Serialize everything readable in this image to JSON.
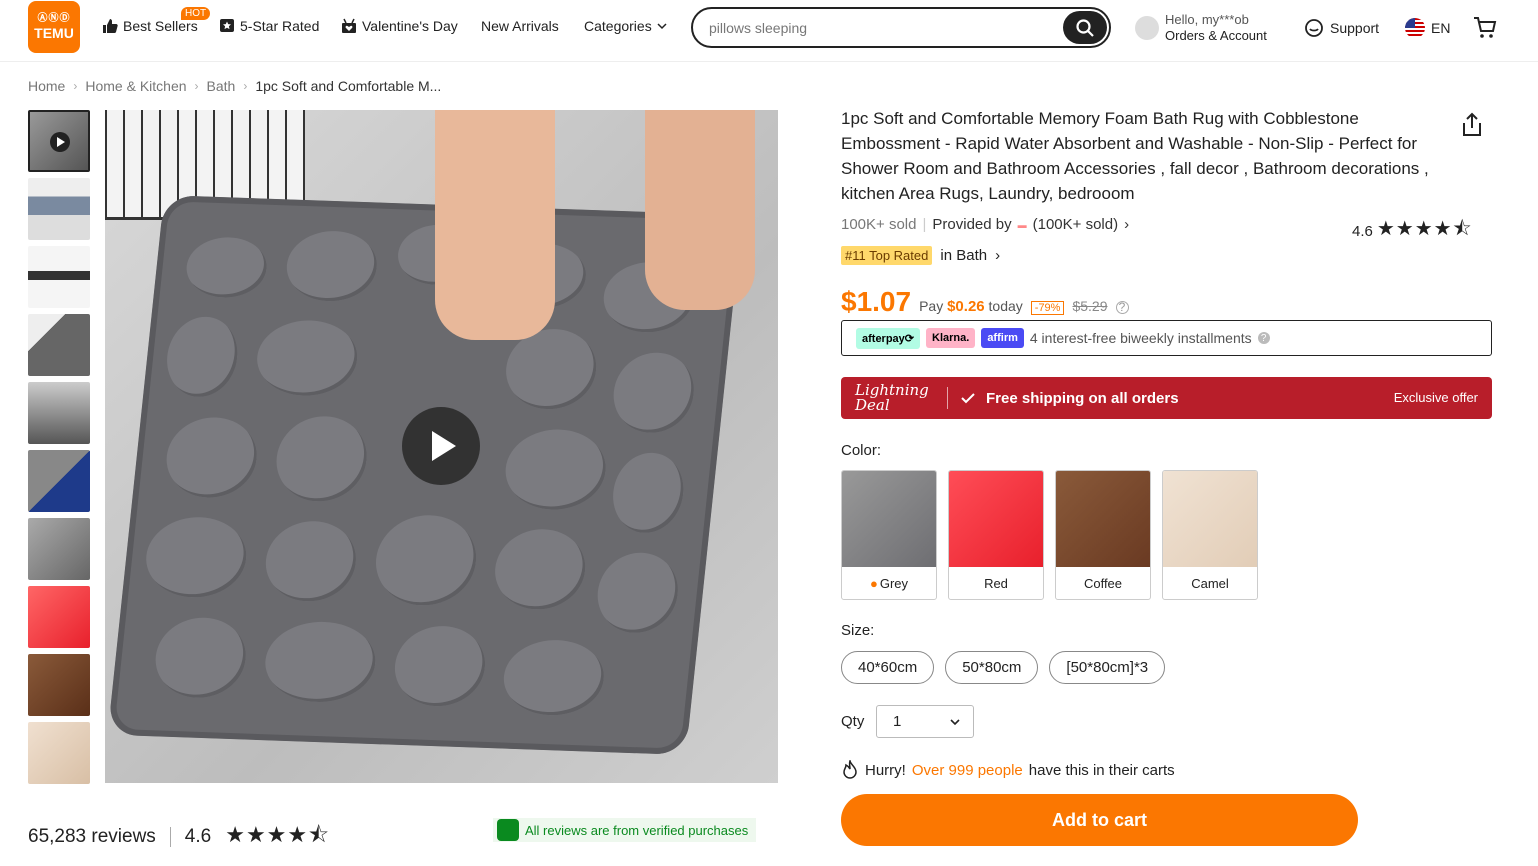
{
  "header": {
    "logo_line1": "ⒶⓃⒹ",
    "logo_text": "TEMU",
    "nav": [
      {
        "label": "Best Sellers",
        "badge": "HOT"
      },
      {
        "label": "5-Star Rated"
      },
      {
        "label": "Valentine's Day"
      },
      {
        "label": "New Arrivals"
      },
      {
        "label": "Categories"
      }
    ],
    "search_value": "pillows sleeping",
    "account_greeting": "Hello, my***ob",
    "account_label": "Orders & Account",
    "support_label": "Support",
    "language": "EN"
  },
  "breadcrumb": [
    "Home",
    "Home & Kitchen",
    "Bath",
    "1pc Soft and Comfortable M..."
  ],
  "product": {
    "title": "1pc Soft and Comfortable Memory Foam Bath Rug with Cobblestone Embossment - Rapid Water Absorbent and Washable - Non-Slip - Perfect for Shower Room and Bathroom Accessories , fall decor , Bathroom decorations , kitchen Area Rugs, Laundry, bedrooom",
    "sold": "100K+ sold",
    "provided_by": "Provided by",
    "provider_sold": "(100K+ sold)",
    "rating": "4.6",
    "top_rated_badge": "#11 Top Rated",
    "top_rated_in": "in Bath",
    "price": "$1.07",
    "pay_prefix": "Pay",
    "pay_amount": "$0.26",
    "pay_suffix": "today",
    "discount": "-79%",
    "original_price": "$5.29",
    "bnpl": {
      "afterpay": "afterpay⟳",
      "klarna": "Klarna.",
      "affirm": "affirm",
      "text": "4 interest-free biweekly installments"
    },
    "lightning": {
      "deal": "Lightning Deal",
      "shipping": "Free shipping on all orders",
      "exclusive": "Exclusive offer"
    },
    "color_label": "Color:",
    "colors": [
      {
        "name": "Grey",
        "hex": "#6e6e72"
      },
      {
        "name": "Red",
        "hex": "#e8202c"
      },
      {
        "name": "Coffee",
        "hex": "#6a3a22"
      },
      {
        "name": "Camel",
        "hex": "#e2cdb7"
      }
    ],
    "size_label": "Size:",
    "sizes": [
      "40*60cm",
      "50*80cm",
      "[50*80cm]*3"
    ],
    "qty_label": "Qty",
    "qty_value": "1",
    "hurry_prefix": "Hurry!",
    "hurry_count": "Over 999 people",
    "hurry_suffix": "have this in their carts",
    "add_to_cart": "Add to cart"
  },
  "reviews": {
    "count": "65,283 reviews",
    "rating": "4.6",
    "verified": "All reviews are from verified purchases"
  },
  "colors": {
    "accent": "#fb7701",
    "lightning": "#b81e2a",
    "verified": "#0a8a1f"
  }
}
